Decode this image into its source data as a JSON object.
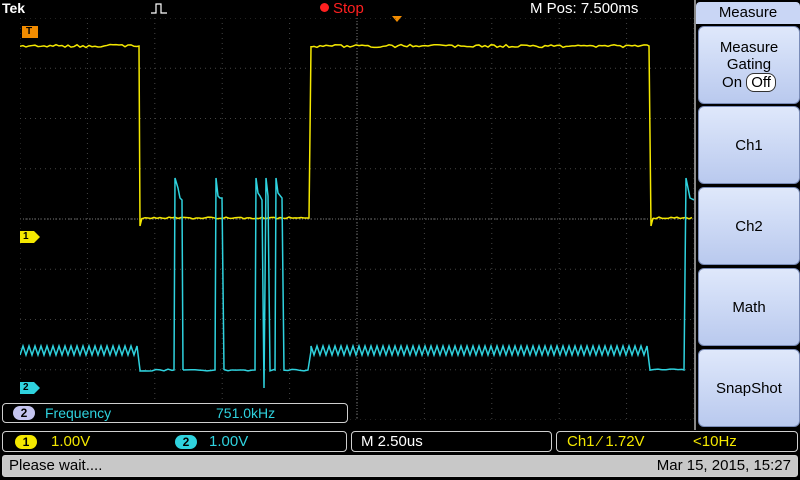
{
  "top": {
    "brand": "Tek",
    "run_state": "Stop",
    "horizontal_position": "M Pos: 7.500ms"
  },
  "colors": {
    "ch1": "#f4e800",
    "ch2": "#2fd2de",
    "trigger": "#f28c00",
    "stop": "#ff2020",
    "menu": "#c9d6f5"
  },
  "markers": {
    "ch1": "1",
    "ch2": "2",
    "trigger": "T"
  },
  "menu": {
    "title": "Measure",
    "gating_label": "Measure Gating",
    "gating_on": "On",
    "gating_off": "Off",
    "btn_ch1": "Ch1",
    "btn_ch2": "Ch2",
    "btn_math": "Math",
    "btn_snapshot": "SnapShot"
  },
  "measurement": {
    "channel": "2",
    "name": "Frequency",
    "value": "751.0kHz"
  },
  "status": {
    "ch1_badge": "1",
    "ch1_scale": "1.00V",
    "ch2_badge": "2",
    "ch2_scale": "1.00V",
    "timebase": "M 2.50us",
    "trigger_source": "Ch1 ⁄ 1.72V",
    "trigger_freq": "<10Hz",
    "message": "Please wait....",
    "datetime": "Mar 15, 2015, 15:27"
  }
}
